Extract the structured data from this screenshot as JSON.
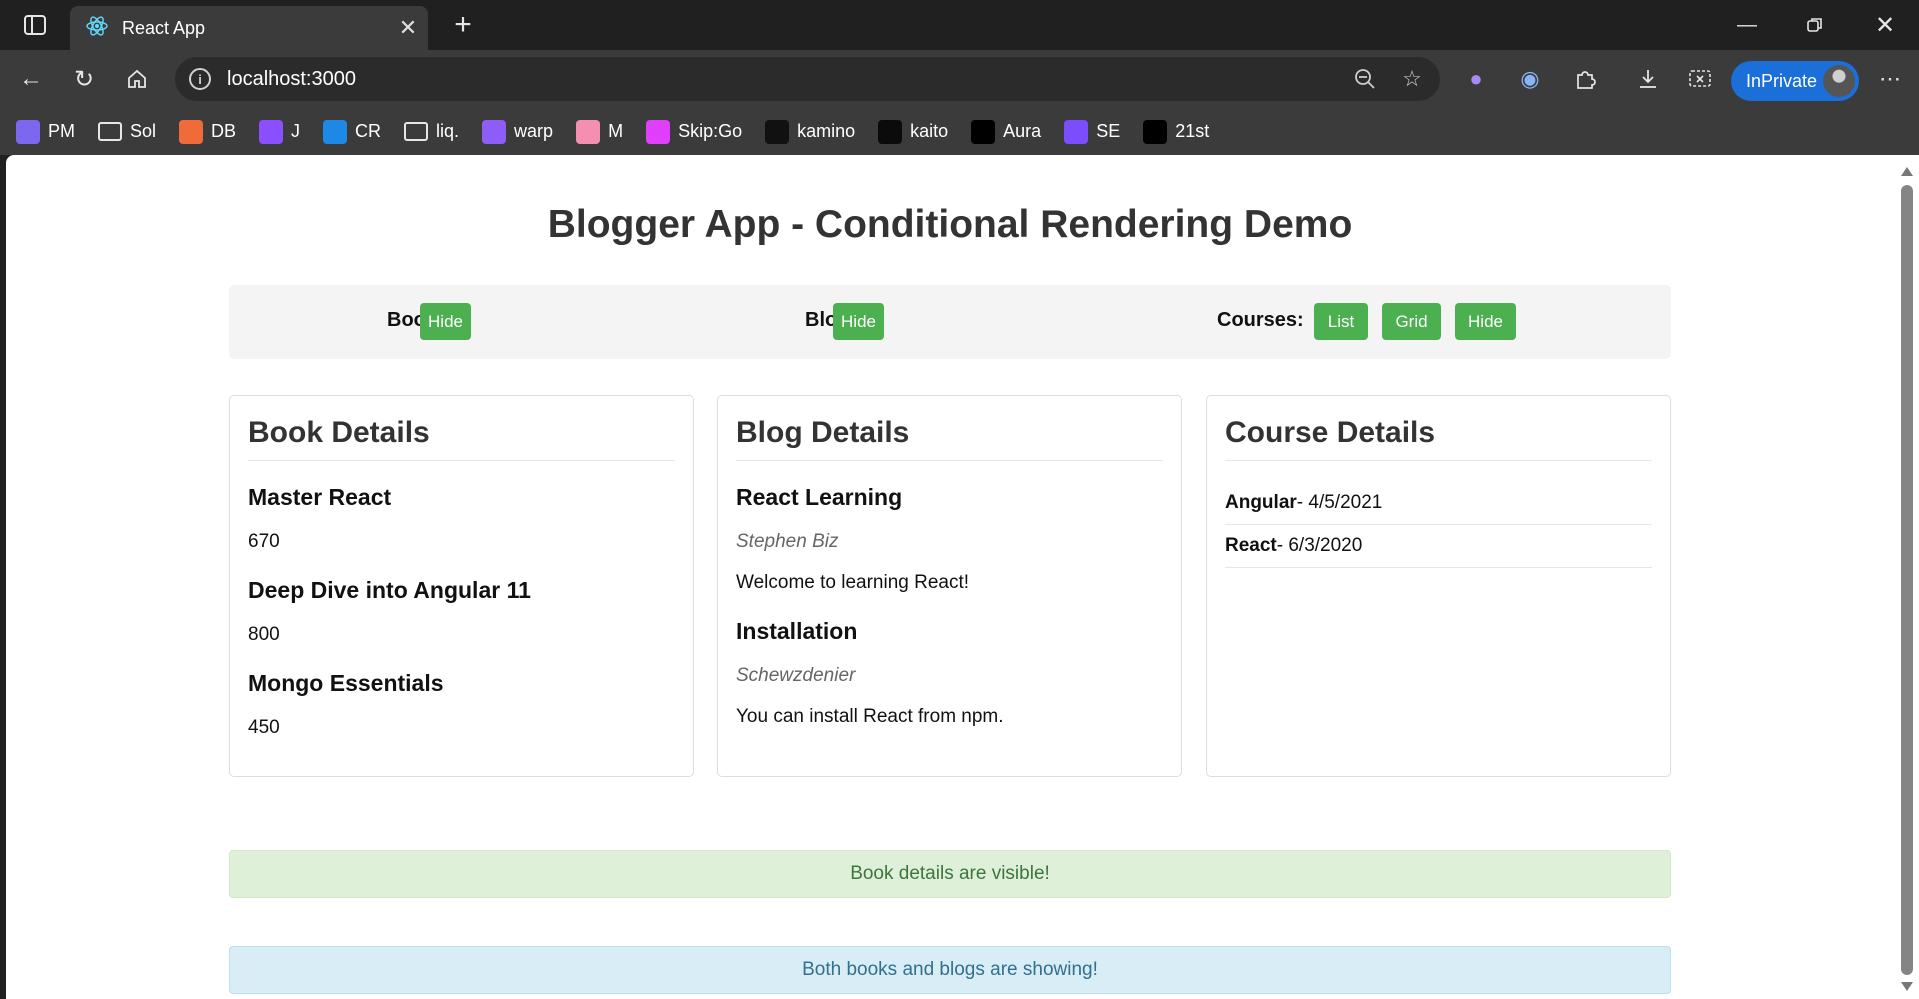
{
  "browser": {
    "tab_title": "React App",
    "url": "localhost:3000",
    "profile_label": "InPrivate",
    "bookmarks": [
      {
        "label": "PM",
        "icon": "gmail-icon",
        "color": "#7b68ee"
      },
      {
        "label": "Sol",
        "icon": "folder-icon",
        "color": ""
      },
      {
        "label": "DB",
        "icon": "db-icon",
        "color": "#f06b3a"
      },
      {
        "label": "J",
        "icon": "j-icon",
        "color": "#8a4fff"
      },
      {
        "label": "CR",
        "icon": "cr-icon",
        "color": "#1e88e5"
      },
      {
        "label": "liq.",
        "icon": "folder-icon",
        "color": ""
      },
      {
        "label": "warp",
        "icon": "warp-icon",
        "color": "#8e5cf7"
      },
      {
        "label": "M",
        "icon": "m-icon",
        "color": "#f48fb1"
      },
      {
        "label": "Skip:Go",
        "icon": "skipgo-icon",
        "color": "#e040fb"
      },
      {
        "label": "kamino",
        "icon": "kamino-icon",
        "color": "#111111"
      },
      {
        "label": "kaito",
        "icon": "kaito-icon",
        "color": "#0b0b0b"
      },
      {
        "label": "Aura",
        "icon": "aura-icon",
        "color": "#000000"
      },
      {
        "label": "SE",
        "icon": "se-icon",
        "color": "#7c4dff"
      },
      {
        "label": "21st",
        "icon": "21st-icon",
        "color": "#000000"
      }
    ]
  },
  "app": {
    "title": "Blogger App - Conditional Rendering Demo",
    "controls": {
      "books_label": "Books:",
      "books_hide": "Hide",
      "blogs_label": "Blogs:",
      "blogs_hide": "Hide",
      "courses_label": "Courses:",
      "courses_list": "List",
      "courses_grid": "Grid",
      "courses_hide": "Hide"
    },
    "books": {
      "heading": "Book Details",
      "items": [
        {
          "name": "Master React",
          "price": "670"
        },
        {
          "name": "Deep Dive into Angular 11",
          "price": "800"
        },
        {
          "name": "Mongo Essentials",
          "price": "450"
        }
      ]
    },
    "blogs": {
      "heading": "Blog Details",
      "items": [
        {
          "title": "React Learning",
          "author": "Stephen Biz",
          "content": "Welcome to learning React!"
        },
        {
          "title": "Installation",
          "author": "Schewzdenier",
          "content": "You can install React from npm."
        }
      ]
    },
    "courses": {
      "heading": "Course Details",
      "items": [
        {
          "name": "Angular",
          "date": " - 4/5/2021"
        },
        {
          "name": "React",
          "date": " - 6/3/2020"
        }
      ]
    },
    "alerts": {
      "success": "Book details are visible!",
      "info": "Both books and blogs are showing!"
    }
  },
  "colors": {
    "button_green": "#4caf50",
    "success_bg": "#dff0d8",
    "info_bg": "#d9edf7"
  }
}
